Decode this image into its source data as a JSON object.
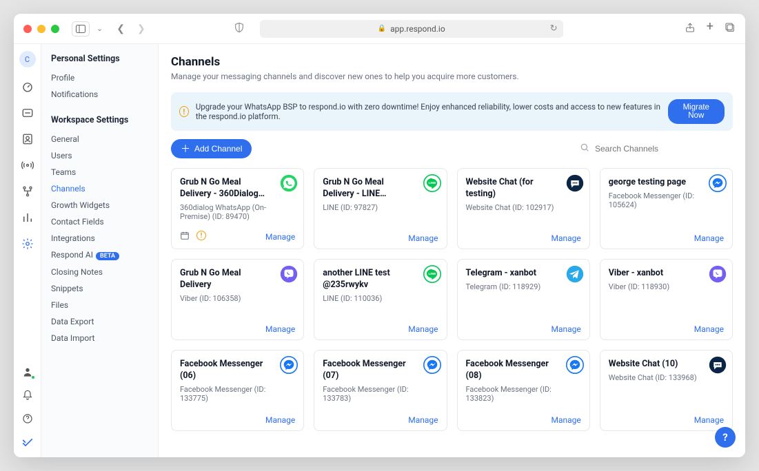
{
  "browser": {
    "url_host": "app.respond.io"
  },
  "rail": {
    "avatar_initial": "C"
  },
  "settings": {
    "personal_title": "Personal Settings",
    "personal_items": [
      "Profile",
      "Notifications"
    ],
    "workspace_title": "Workspace Settings",
    "workspace_items": [
      {
        "label": "General"
      },
      {
        "label": "Users"
      },
      {
        "label": "Teams"
      },
      {
        "label": "Channels",
        "active": true
      },
      {
        "label": "Growth Widgets"
      },
      {
        "label": "Contact Fields"
      },
      {
        "label": "Integrations"
      },
      {
        "label": "Respond AI",
        "beta": true
      },
      {
        "label": "Closing Notes"
      },
      {
        "label": "Snippets"
      },
      {
        "label": "Files"
      },
      {
        "label": "Data Export"
      },
      {
        "label": "Data Import"
      }
    ],
    "beta_label": "BETA"
  },
  "page": {
    "title": "Channels",
    "subtitle": "Manage your messaging channels and discover new ones to help you acquire more customers."
  },
  "banner": {
    "text": "Upgrade your WhatsApp BSP to respond.io with zero downtime! Enjoy enhanced reliability, lower costs and access to new features in the respond.io platform.",
    "cta": "Migrate Now"
  },
  "toolbar": {
    "add_label": "Add Channel",
    "search_placeholder": "Search Channels"
  },
  "common": {
    "manage": "Manage"
  },
  "channels": [
    {
      "title": "Grub N Go Meal Delivery - 360Dialog…",
      "sub": "360dialog WhatsApp (On-Premise) (ID: 89470)",
      "icon": "whatsapp",
      "hasFooterIcons": true
    },
    {
      "title": "Grub N Go Meal Delivery - LINE…",
      "sub": "LINE (ID: 97827)",
      "icon": "line"
    },
    {
      "title": "Website Chat (for testing)",
      "sub": "Website Chat (ID: 102917)",
      "icon": "chat-dark"
    },
    {
      "title": "george testing page",
      "sub": "Facebook Messenger (ID: 105624)",
      "icon": "messenger"
    },
    {
      "title": "Grub N Go Meal Delivery",
      "sub": "Viber (ID: 106358)",
      "icon": "viber"
    },
    {
      "title": "another LINE test @235rwykv",
      "sub": "LINE (ID: 110036)",
      "icon": "line"
    },
    {
      "title": "Telegram - xanbot",
      "sub": "Telegram (ID: 118929)",
      "icon": "telegram"
    },
    {
      "title": "Viber - xanbot",
      "sub": "Viber (ID: 118930)",
      "icon": "viber"
    },
    {
      "title": "Facebook Messenger (06)",
      "sub": "Facebook Messenger (ID: 133775)",
      "icon": "messenger"
    },
    {
      "title": "Facebook Messenger (07)",
      "sub": "Facebook Messenger (ID: 133783)",
      "icon": "messenger"
    },
    {
      "title": "Facebook Messenger (08)",
      "sub": "Facebook Messenger (ID: 133823)",
      "icon": "messenger"
    },
    {
      "title": "Website Chat (10)",
      "sub": "Website Chat (ID: 133968)",
      "icon": "chat-dark"
    }
  ]
}
